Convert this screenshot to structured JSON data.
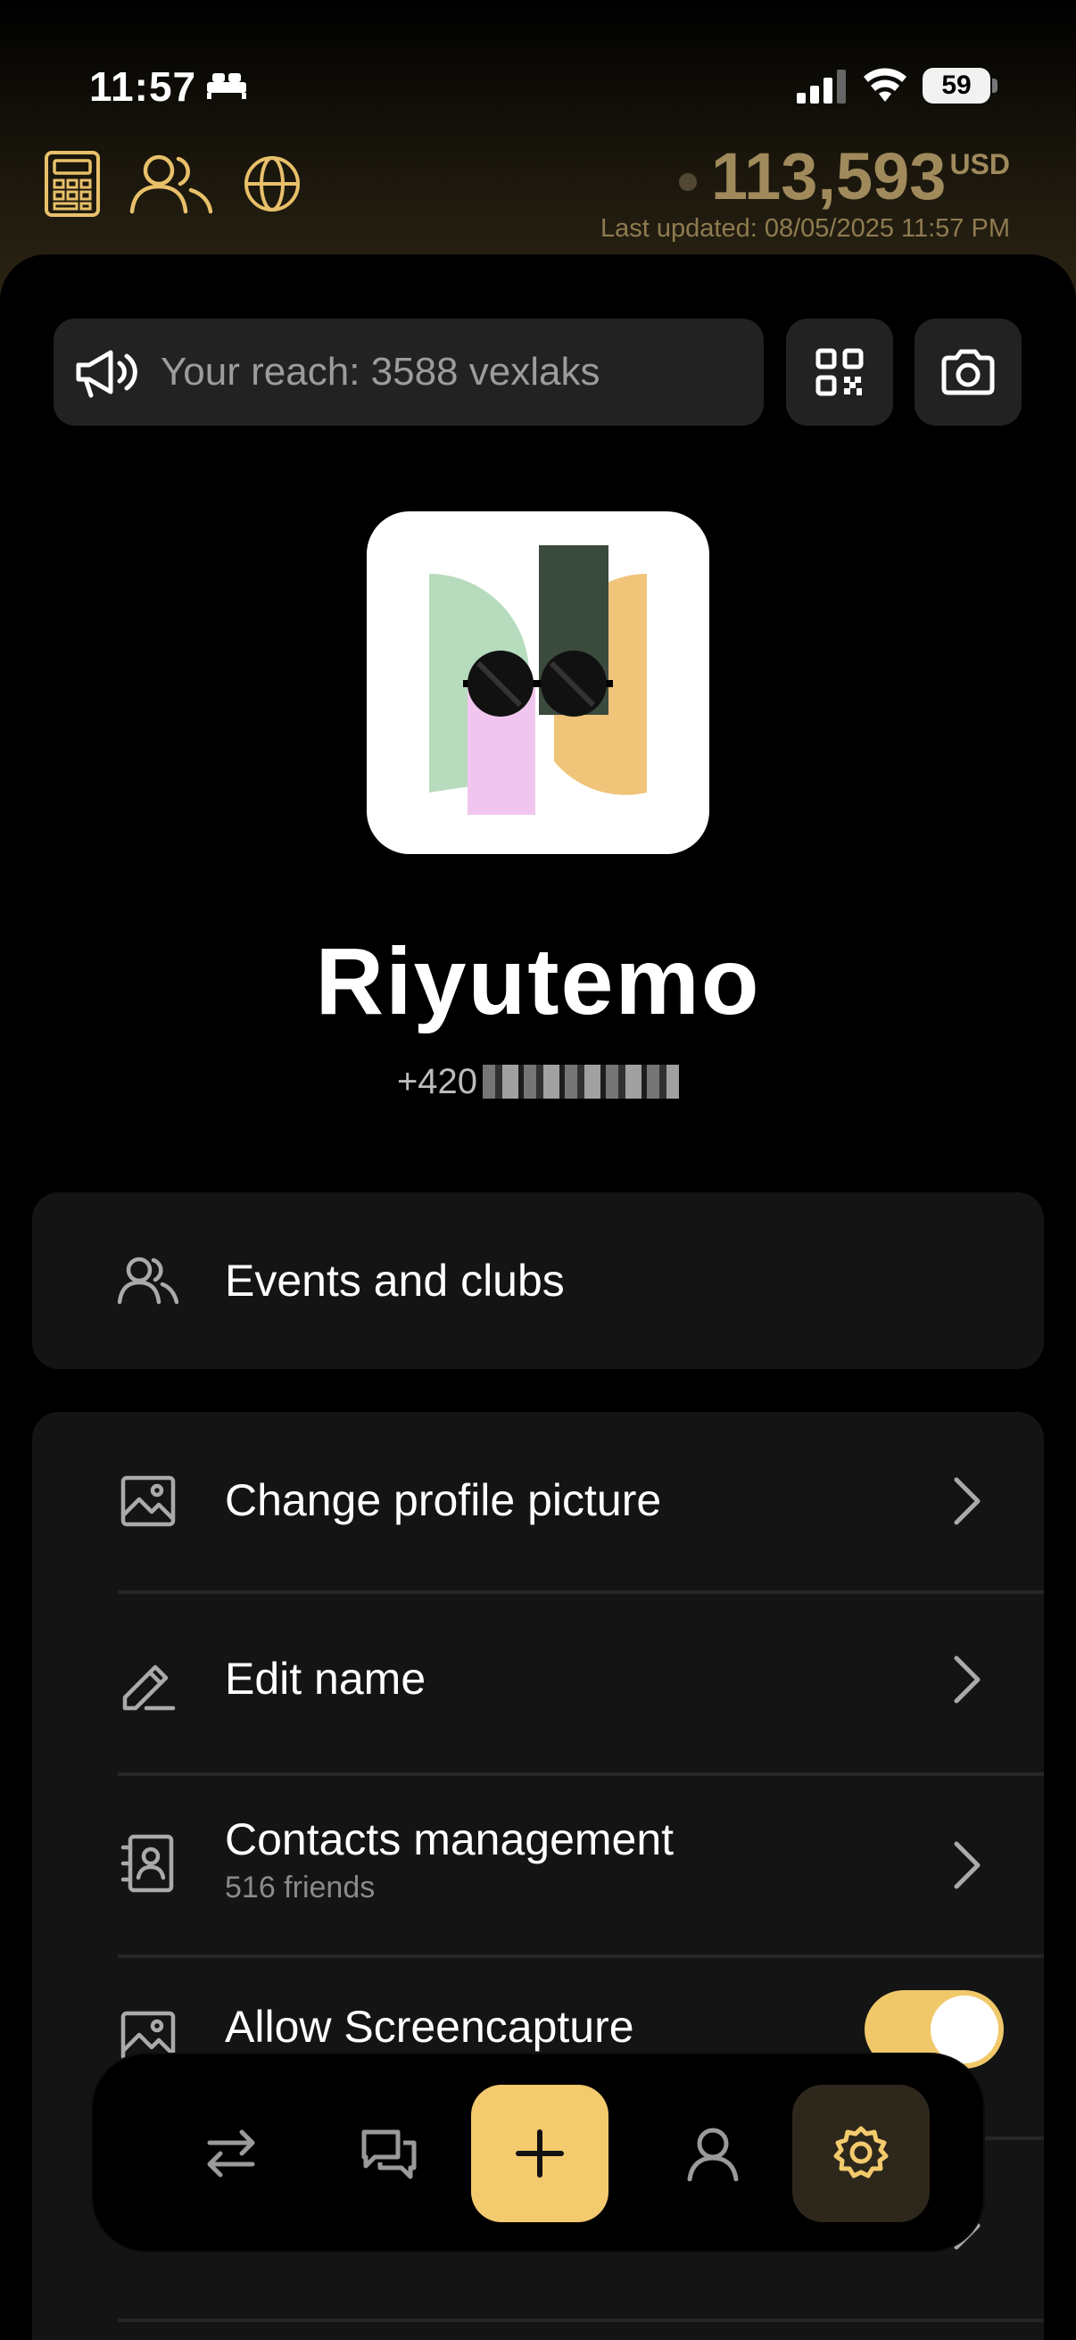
{
  "status_bar": {
    "time": "11:57",
    "battery": "59",
    "icons": [
      "bed-icon",
      "signal-icon",
      "wifi-icon",
      "battery-icon"
    ]
  },
  "header": {
    "icons": [
      "calculator-icon",
      "people-icon",
      "globe-icon"
    ],
    "balance_amount": "113,593",
    "balance_currency": "USD",
    "last_updated": "Last updated: 08/05/2025 11:57 PM",
    "accent_color": "#a08a5c"
  },
  "reach": {
    "text": "Your reach: 3588 vexlaks",
    "icon": "megaphone-icon"
  },
  "actions": {
    "qr_icon": "qr-code-icon",
    "camera_icon": "camera-icon"
  },
  "profile": {
    "name": "Riyutemo",
    "phone_prefix": "+420"
  },
  "menu": {
    "events": {
      "label": "Events and clubs",
      "icon": "people-icon"
    },
    "items": [
      {
        "label": "Change profile picture",
        "icon": "image-icon"
      },
      {
        "label": "Edit name",
        "icon": "pencil-icon"
      },
      {
        "label": "Contacts management",
        "sublabel": "516 friends",
        "icon": "contacts-book-icon"
      },
      {
        "label": "Allow Screencapture",
        "icon": "image-icon",
        "toggle": true
      }
    ]
  },
  "bottom_nav": {
    "items": [
      "transfer-icon",
      "chat-icon",
      "add-icon",
      "profile-icon",
      "settings-icon"
    ],
    "active": "settings-icon",
    "accent_color": "#f3ca6d"
  }
}
